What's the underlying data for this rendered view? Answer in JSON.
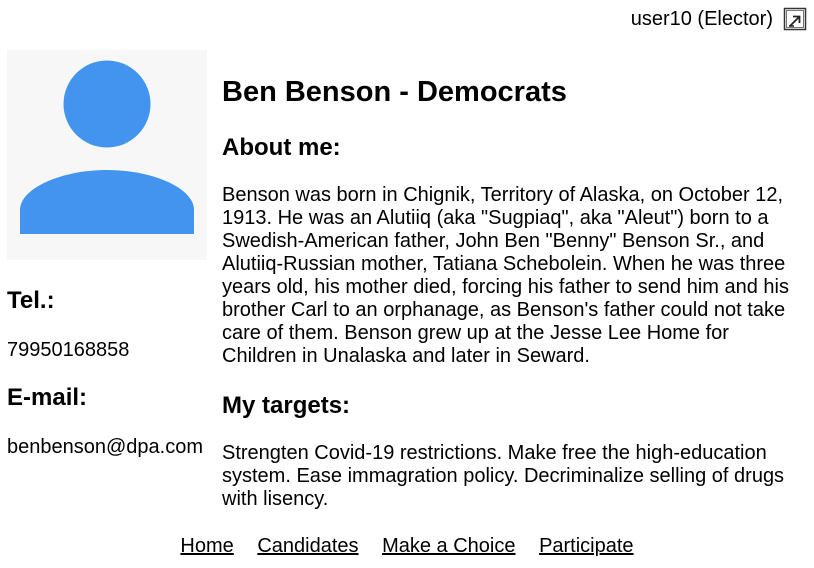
{
  "header": {
    "user_label": "user10 (Elector)",
    "logout_icon": "logout-icon"
  },
  "profile": {
    "avatar_icon": "user-avatar-icon",
    "avatar_color": "#4394ee",
    "name_party": "Ben Benson - Democrats",
    "tel_heading": "Tel.:",
    "tel_value": "79950168858",
    "email_heading": "E-mail:",
    "email_value": "benbenson@dpa.com",
    "about_heading": "About me:",
    "about_text": "Benson was born in Chignik, Territory of Alaska, on October 12, 1913. He was an Alutiiq (aka \"Sugpiaq\", aka \"Aleut\") born to a Swedish-American father, John Ben \"Benny\" Benson Sr., and Alutiiq-Russian mother, Tatiana Schebolein. When he was three years old, his mother died, forcing his father to send him and his brother Carl to an orphanage, as Benson's father could not take care of them. Benson grew up at the Jesse Lee Home for Children in Unalaska and later in Seward.",
    "targets_heading": "My targets:",
    "targets_text": "Strengten Covid-19 restrictions. Make free the high-education system. Ease immagration policy. Decriminalize selling of drugs with lisency."
  },
  "nav": {
    "home": "Home",
    "candidates": "Candidates",
    "make_choice": "Make a Choice",
    "participate": "Participate"
  }
}
